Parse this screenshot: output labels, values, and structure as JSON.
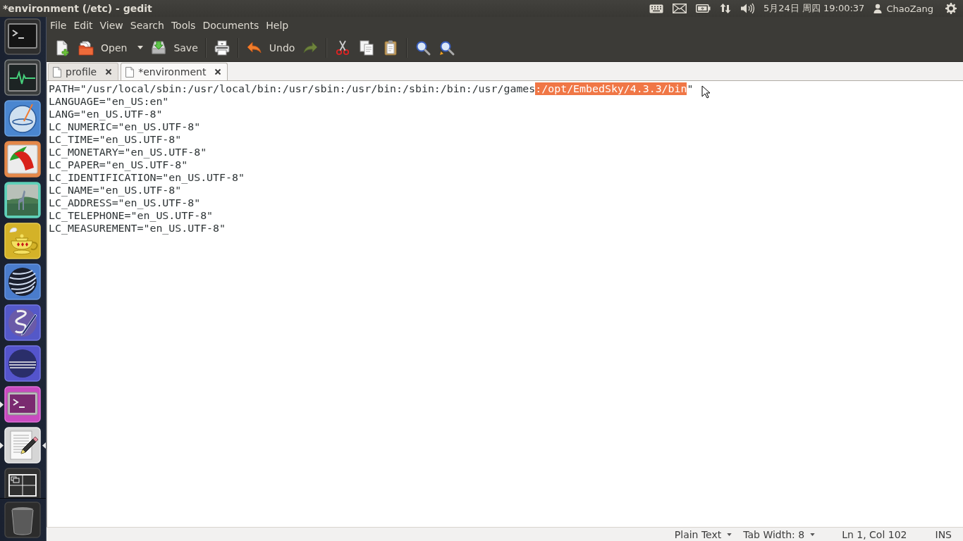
{
  "window": {
    "title": "*environment (/etc) - gedit"
  },
  "panel": {
    "date_time": "5月24日 周四 19:00:37",
    "user": "ChaoZang"
  },
  "launcher": [
    {
      "running": false,
      "focused": false
    },
    {
      "running": false,
      "focused": false
    },
    {
      "running": false,
      "focused": false
    },
    {
      "running": false,
      "focused": false
    },
    {
      "running": false,
      "focused": false
    },
    {
      "running": false,
      "focused": false
    },
    {
      "running": false,
      "focused": false
    },
    {
      "running": false,
      "focused": false
    },
    {
      "running": false,
      "focused": false
    },
    {
      "running": true,
      "focused": false
    },
    {
      "running": true,
      "focused": true
    },
    {
      "running": false,
      "focused": false
    }
  ],
  "menu_bar": [
    "File",
    "Edit",
    "View",
    "Search",
    "Tools",
    "Documents",
    "Help"
  ],
  "toolbar": [
    {
      "kind": "button",
      "disabled": false
    },
    {
      "kind": "menu_button",
      "label": "Open",
      "disabled": false
    },
    {
      "kind": "button",
      "label": "Save",
      "disabled": false
    },
    {
      "kind": "separator"
    },
    {
      "kind": "button",
      "disabled": false
    },
    {
      "kind": "separator"
    },
    {
      "kind": "button",
      "label": "Undo",
      "disabled": false
    },
    {
      "kind": "button",
      "disabled": true
    },
    {
      "kind": "separator"
    },
    {
      "kind": "button",
      "disabled": false
    },
    {
      "kind": "button",
      "disabled": false
    },
    {
      "kind": "button",
      "disabled": false
    },
    {
      "kind": "separator"
    },
    {
      "kind": "button",
      "disabled": false
    },
    {
      "kind": "button",
      "disabled": false
    }
  ],
  "tabs": [
    {
      "label": "profile",
      "selected": false
    },
    {
      "label": "*environment",
      "selected": true
    }
  ],
  "lines": [
    [
      {
        "text": "PATH=\"/usr/local/sbin:/usr/local/bin:/usr/sbin:/usr/bin:/sbin:/bin:/usr/games",
        "selected": false
      },
      {
        "text": ":/opt/EmbedSky/4.3.3/bin",
        "selected": true
      },
      {
        "text": "\"",
        "selected": false
      }
    ],
    [
      {
        "text": "LANGUAGE=\"en_US:en\"",
        "selected": false
      }
    ],
    [
      {
        "text": "LANG=\"en_US.UTF-8\"",
        "selected": false
      }
    ],
    [
      {
        "text": "LC_NUMERIC=\"en_US.UTF-8\"",
        "selected": false
      }
    ],
    [
      {
        "text": "LC_TIME=\"en_US.UTF-8\"",
        "selected": false
      }
    ],
    [
      {
        "text": "LC_MONETARY=\"en_US.UTF-8\"",
        "selected": false
      }
    ],
    [
      {
        "text": "LC_PAPER=\"en_US.UTF-8\"",
        "selected": false
      }
    ],
    [
      {
        "text": "LC_IDENTIFICATION=\"en_US.UTF-8\"",
        "selected": false
      }
    ],
    [
      {
        "text": "LC_NAME=\"en_US.UTF-8\"",
        "selected": false
      }
    ],
    [
      {
        "text": "LC_ADDRESS=\"en_US.UTF-8\"",
        "selected": false
      }
    ],
    [
      {
        "text": "LC_TELEPHONE=\"en_US.UTF-8\"",
        "selected": false
      }
    ],
    [
      {
        "text": "LC_MEASUREMENT=\"en_US.UTF-8\"",
        "selected": false
      }
    ]
  ],
  "status_bar": {
    "language": "Plain Text",
    "tab_width": "Tab Width: 8",
    "position": "Ln 1, Col 102",
    "mode": "INS"
  }
}
